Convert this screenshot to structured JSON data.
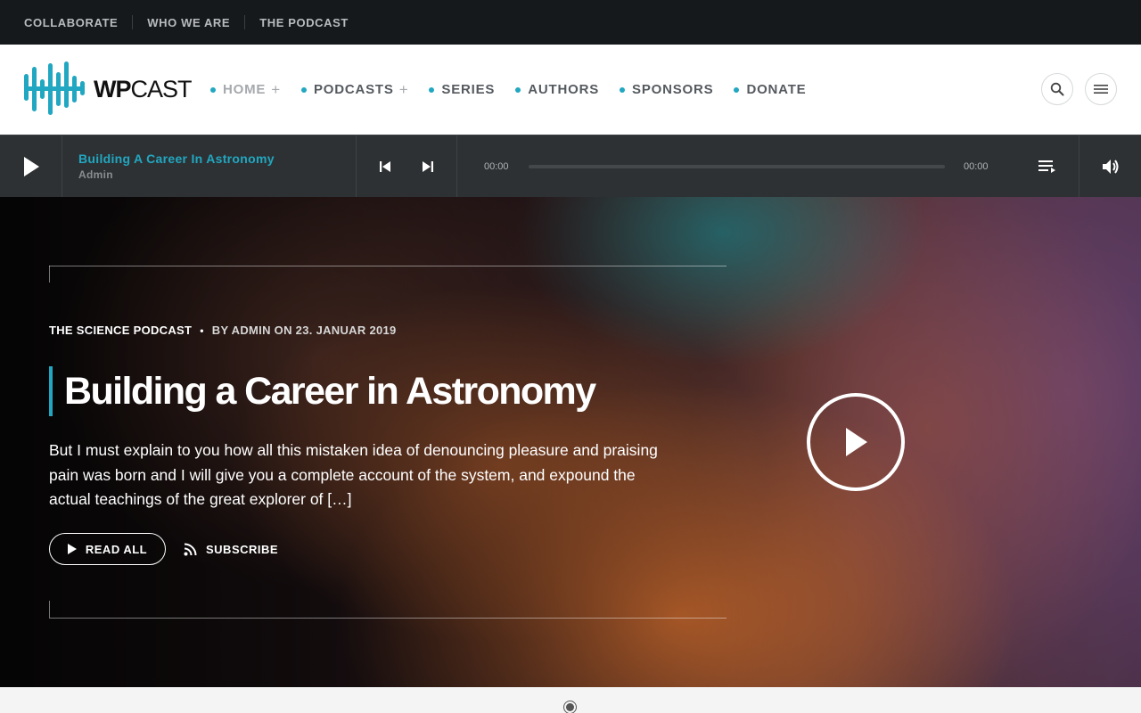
{
  "topbar": {
    "links": [
      "COLLABORATE",
      "WHO WE ARE",
      "THE PODCAST"
    ]
  },
  "header": {
    "logo_text_bold": "WP",
    "logo_text_light": "CAST",
    "nav": [
      {
        "label": "HOME",
        "has_submenu": true,
        "active": true
      },
      {
        "label": "PODCASTS",
        "has_submenu": true,
        "active": false
      },
      {
        "label": "SERIES",
        "has_submenu": false,
        "active": false
      },
      {
        "label": "AUTHORS",
        "has_submenu": false,
        "active": false
      },
      {
        "label": "SPONSORS",
        "has_submenu": false,
        "active": false
      },
      {
        "label": "DONATE",
        "has_submenu": false,
        "active": false
      }
    ],
    "submenu_symbol": "+",
    "icons": [
      "search-icon",
      "menu-icon"
    ]
  },
  "player": {
    "track_title": "Building A Career In Astronomy",
    "track_author": "Admin",
    "current_time": "00:00",
    "duration": "00:00",
    "progress": 0,
    "icons": [
      "play-icon",
      "previous-icon",
      "next-icon",
      "playlist-icon",
      "volume-icon"
    ]
  },
  "hero": {
    "category": "THE SCIENCE PODCAST",
    "bullet": "•",
    "byline": "BY ADMIN ON 23. JANUAR 2019",
    "title": "Building a Career in Astronomy",
    "excerpt": "But I must explain to you how all this mistaken idea of denouncing pleasure and praising pain was born and I will give you a complete account of the system, and expound the actual teachings of the great explorer of […]",
    "read_button": "READ ALL",
    "subscribe_button": "SUBSCRIBE"
  },
  "colors": {
    "accent": "#21a7c1",
    "topbar_bg": "#16191c",
    "player_bg": "#2e3133"
  }
}
